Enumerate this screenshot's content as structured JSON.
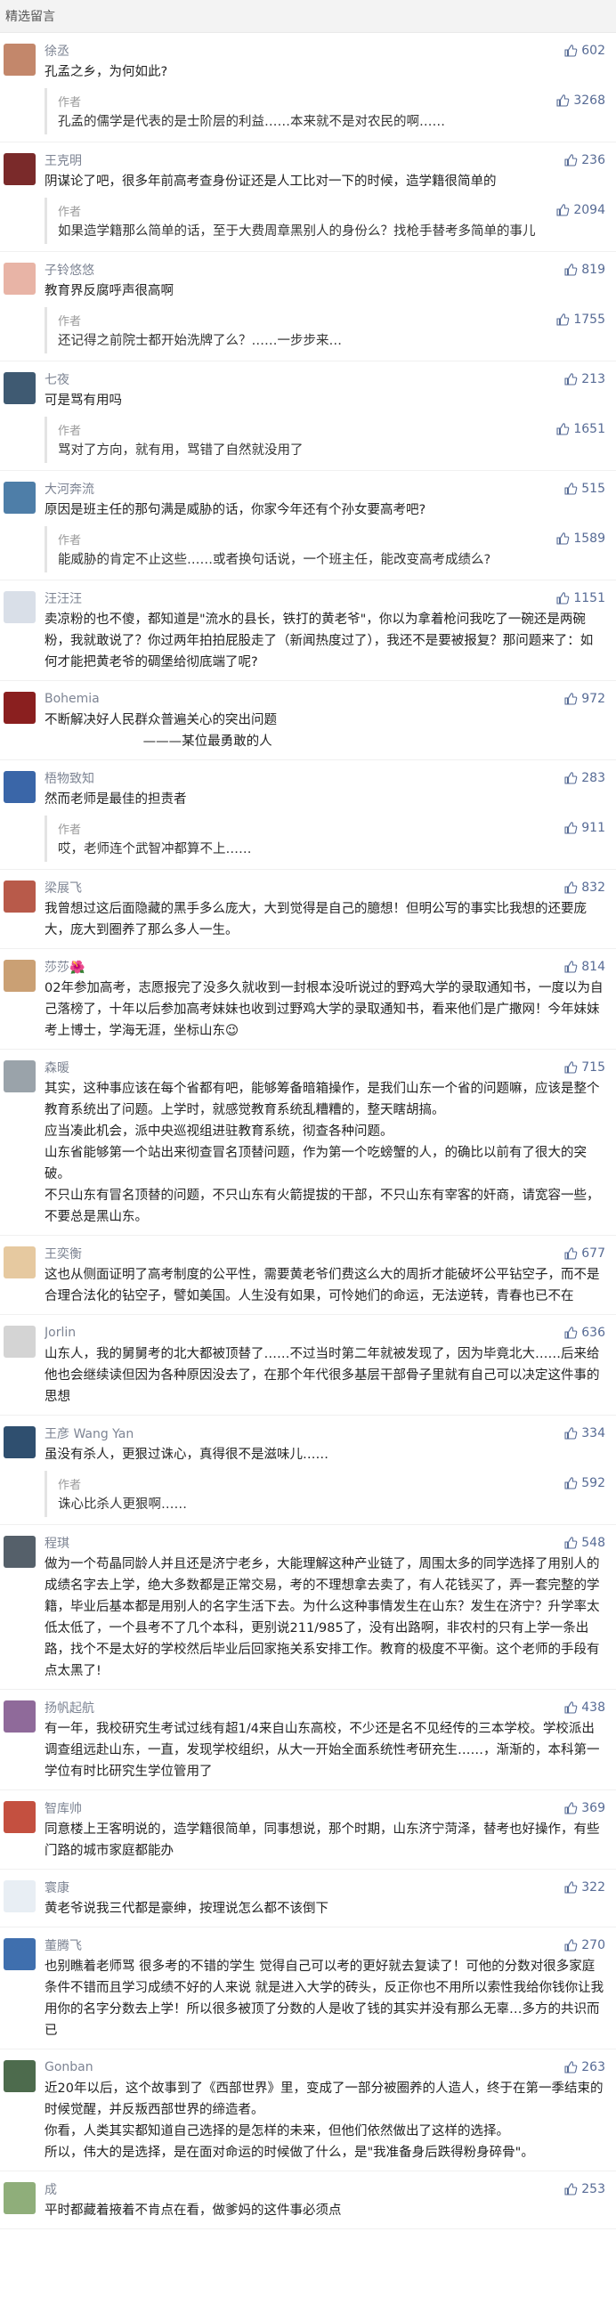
{
  "header": "精选留言",
  "colors": {
    "accent": "#576b95",
    "name": "#7d8493"
  },
  "comments": [
    {
      "name": "徐丞",
      "likes": "602",
      "text": "孔孟之乡，为何如此?",
      "avatar_color": "#c3876b",
      "reply": {
        "author": "作者",
        "likes": "3268",
        "text": "孔孟的儒学是代表的是士阶层的利益……本来就不是对农民的啊……"
      }
    },
    {
      "name": "王克明",
      "likes": "236",
      "text": "阴谋论了吧，很多年前高考查身份证还是人工比对一下的时候，造学籍很简单的",
      "avatar_color": "#7a2a2a",
      "reply": {
        "author": "作者",
        "likes": "2094",
        "text": "如果造学籍那么简单的话，至于大费周章黑别人的身份么？找枪手替考多简单的事儿"
      }
    },
    {
      "name": "子铃悠悠",
      "likes": "819",
      "text": "教育界反腐呼声很高啊",
      "avatar_color": "#e8b4a6",
      "reply": {
        "author": "作者",
        "likes": "1755",
        "text": "还记得之前院士都开始洗牌了么？……一步步来…"
      }
    },
    {
      "name": "七夜",
      "likes": "213",
      "text": "可是骂有用吗",
      "avatar_color": "#3f5a72",
      "reply": {
        "author": "作者",
        "likes": "1651",
        "text": "骂对了方向，就有用，骂错了自然就没用了"
      }
    },
    {
      "name": "大河奔流",
      "likes": "515",
      "text": "原因是班主任的那句满是威胁的话，你家今年还有个孙女要高考吧?",
      "avatar_color": "#4e7ea8",
      "reply": {
        "author": "作者",
        "likes": "1589",
        "text": "能威胁的肯定不止这些……或者换句话说，一个班主任，能改变高考成绩么?"
      }
    },
    {
      "name": "汪汪汪",
      "likes": "1151",
      "text": "卖凉粉的也不傻，都知道是\"流水的县长，铁打的黄老爷\"，你以为拿着枪问我吃了一碗还是两碗粉，我就敢说了？你过两年拍拍屁股走了（新闻热度过了），我还不是要被报复？那问题来了：如何才能把黄老爷的碉堡给彻底端了呢?",
      "avatar_color": "#d9dfe8"
    },
    {
      "name": "Bohemia",
      "likes": "972",
      "text": "不断解决好人民群众普遍关心的突出问题\n                        ———某位最勇敢的人",
      "avatar_color": "#8a1f1f"
    },
    {
      "name": "梧物致知",
      "likes": "283",
      "text": "然而老师是最佳的担责者",
      "avatar_color": "#3a66a8",
      "reply": {
        "author": "作者",
        "likes": "911",
        "text": "哎，老师连个武智冲都算不上……"
      }
    },
    {
      "name": "梁展飞",
      "likes": "832",
      "text": "我曾想过这后面隐藏的黑手多么庞大，大到觉得是自己的臆想！但明公写的事实比我想的还要庞大，庞大到圈养了那么多人一生。",
      "avatar_color": "#b85a4a"
    },
    {
      "name": "莎莎🌺",
      "likes": "814",
      "text": "02年参加高考，志愿报完了没多久就收到一封根本没听说过的野鸡大学的录取通知书，一度以为自己落榜了，十年以后参加高考妹妹也收到过野鸡大学的录取通知书，看来他们是广撒网！今年妹妹考上博士，学海无涯，坐标山东😉",
      "avatar_color": "#caa074"
    },
    {
      "name": "森暖",
      "likes": "715",
      "text": "其实，这种事应该在每个省都有吧，能够筹备暗箱操作，是我们山东一个省的问题嘛，应该是整个教育系统出了问题。上学时，就感觉教育系统乱糟糟的，整天瞎胡搞。\n应当凑此机会，派中央巡视组进驻教育系统，彻查各种问题。\n山东省能够第一个站出来彻查冒名顶替问题，作为第一个吃螃蟹的人，的确比以前有了很大的突破。\n不只山东有冒名顶替的问题，不只山东有火箭提拔的干部，不只山东有宰客的奸商，请宽容一些，不要总是黑山东。",
      "avatar_color": "#9aa3aa"
    },
    {
      "name": "王奕衡",
      "likes": "677",
      "text": "这也从侧面证明了高考制度的公平性，需要黄老爷们费这么大的周折才能破坏公平钻空子，而不是合理合法化的钻空子，譬如美国。人生没有如果，可怜她们的命运，无法逆转，青春也已不在",
      "avatar_color": "#e6c9a0"
    },
    {
      "name": "Jorlin",
      "likes": "636",
      "text": "山东人，我的舅舅考的北大都被顶替了……不过当时第二年就被发现了，因为毕竟北大……后来给他也会继续读但因为各种原因没去了，在那个年代很多基层干部骨子里就有自己可以决定这件事的思想",
      "avatar_color": "#d4d4d4"
    },
    {
      "name": "王彦 Wang Yan",
      "likes": "334",
      "text": "虽没有杀人，更狠过诛心，真得很不是滋味儿……",
      "avatar_color": "#2f4f6f",
      "reply": {
        "author": "作者",
        "likes": "592",
        "text": "诛心比杀人更狠啊……"
      }
    },
    {
      "name": "程琪",
      "likes": "548",
      "text": "做为一个苟晶同龄人并且还是济宁老乡，大能理解这种产业链了，周围太多的同学选择了用别人的成绩名字去上学，绝大多数都是正常交易，考的不理想拿去卖了，有人花钱买了，弄一套完整的学籍，毕业后基本都是用别人的名字生活下去。为什么这种事情发生在山东？发生在济宁？升学率太低太低了，一个县考不了几个本科，更别说211/985了，没有出路啊，非农村的只有上学一条出路，找个不是太好的学校然后毕业后回家拖关系安排工作。教育的极度不平衡。这个老师的手段有点太黑了!",
      "avatar_color": "#55606a"
    },
    {
      "name": "扬帆起航",
      "likes": "438",
      "text": "有一年，我校研究生考试过线有超1/4来自山东高校，不少还是名不见经传的三本学校。学校派出调查组远赴山东，一直，发现学校组织，从大一开始全面系统性考研充生……，渐渐的，本科第一学位有时比研究生学位管用了",
      "avatar_color": "#8f6a9a"
    },
    {
      "name": "智库帅",
      "likes": "369",
      "text": "同意楼上王客明说的，造学籍很简单，同事想说，那个时期，山东济宁菏泽，替考也好操作，有些门路的城市家庭都能办",
      "avatar_color": "#c45040"
    },
    {
      "name": "寰康",
      "likes": "322",
      "text": "黄老爷说我三代都是豪绅，按理说怎么都不该倒下",
      "avatar_color": "#e8eef4"
    },
    {
      "name": "董腾飞",
      "likes": "270",
      "text": "也别瞧着老师骂 很多考的不错的学生 觉得自己可以考的更好就去复读了！可他的分数对很多家庭条件不错而且学习成绩不好的人来说 就是进入大学的砖头，反正你也不用所以索性我给你钱你让我用你的名字分数去上学！所以很多被顶了分数的人是收了钱的其实并没有那么无辜…多方的共识而已",
      "avatar_color": "#3f6fae"
    },
    {
      "name": "Gonban",
      "likes": "263",
      "text": "近20年以后，这个故事到了《西部世界》里，变成了一部分被圈养的人造人，终于在第一季结束的时候觉醒，并反叛西部世界的缔造者。\n你看，人类其实都知道自己选择的是怎样的未来，但他们依然做出了这样的选择。\n所以，伟大的是选择，是在面对命运的时候做了什么，是\"我准备身后跌得粉身碎骨\"。",
      "avatar_color": "#4d6b4d"
    },
    {
      "name": "成",
      "likes": "253",
      "text": "平时都藏着掖着不肯点在看，做爹妈的这件事必须点",
      "avatar_color": "#8fae7a"
    }
  ]
}
